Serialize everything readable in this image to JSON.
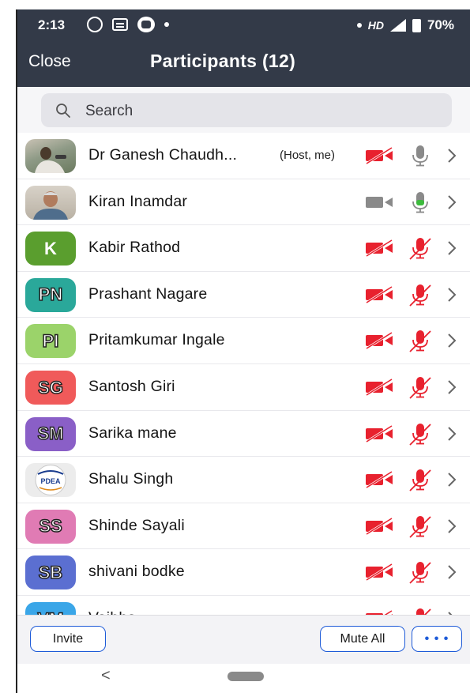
{
  "status_bar": {
    "time": "2:13",
    "network": "HD",
    "battery": "70%"
  },
  "header": {
    "close_label": "Close",
    "title": "Participants (12)"
  },
  "search": {
    "placeholder": "Search"
  },
  "participants": [
    {
      "name": "Dr Ganesh Chaudh...",
      "tag": "(Host, me)",
      "avatar_text": "",
      "avatar_type": "photo-1",
      "video": "off",
      "mic": "muted-gray"
    },
    {
      "name": "Kiran Inamdar",
      "tag": "",
      "avatar_text": "",
      "avatar_type": "photo-2",
      "video": "on",
      "mic": "active"
    },
    {
      "name": "Kabir Rathod",
      "tag": "",
      "avatar_text": "K",
      "avatar_color": "#5a9e2e",
      "video": "off",
      "mic": "off"
    },
    {
      "name": "Prashant Nagare",
      "tag": "",
      "avatar_text": "PN",
      "avatar_color": "#2aa89a",
      "video": "off",
      "mic": "off"
    },
    {
      "name": "Pritamkumar Ingale",
      "tag": "",
      "avatar_text": "PI",
      "avatar_color": "#9bd36a",
      "video": "off",
      "mic": "off"
    },
    {
      "name": "Santosh Giri",
      "tag": "",
      "avatar_text": "SG",
      "avatar_color": "#f05a5a",
      "video": "off",
      "mic": "off"
    },
    {
      "name": "Sarika mane",
      "tag": "",
      "avatar_text": "SM",
      "avatar_color": "#8a5fc7",
      "video": "off",
      "mic": "off"
    },
    {
      "name": "Shalu Singh",
      "tag": "",
      "avatar_text": "PDEA",
      "avatar_type": "logo",
      "video": "off",
      "mic": "off"
    },
    {
      "name": "Shinde Sayali",
      "tag": "",
      "avatar_text": "SS",
      "avatar_color": "#e07bb4",
      "video": "off",
      "mic": "off"
    },
    {
      "name": "shivani bodke",
      "tag": "",
      "avatar_text": "SB",
      "avatar_color": "#5b6fd1",
      "video": "off",
      "mic": "off"
    },
    {
      "name": "Vaibha...",
      "tag": "",
      "avatar_text": "VM",
      "avatar_color": "#3aa6e8",
      "video": "off",
      "mic": "off"
    }
  ],
  "toolbar": {
    "invite_label": "Invite",
    "mute_all_label": "Mute All",
    "more_label": "• • •"
  },
  "navbar": {
    "back_glyph": "<"
  },
  "colors": {
    "header_bg": "#333a48",
    "muted_red": "#e8212e",
    "accent_blue": "#1e5bd8",
    "active_green": "#3dbb3d"
  }
}
